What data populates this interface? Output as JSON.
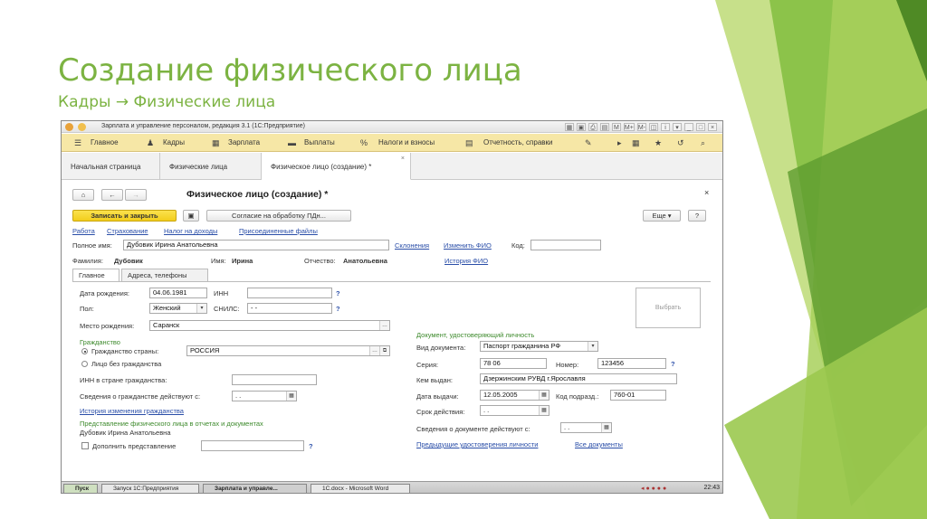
{
  "slide": {
    "title": "Создание физического лица",
    "subtitle": "Кадры → Физические лица"
  },
  "window": {
    "title": "Зарплата и управление персоналом, редакция 3.1 (1С:Предприятие)",
    "toolbar_icons": [
      "M",
      "M+",
      "M-"
    ]
  },
  "menu": {
    "items": [
      "Главное",
      "Кадры",
      "Зарплата",
      "Выплаты",
      "Налоги и взносы",
      "Отчетность, справки"
    ]
  },
  "page_tabs": [
    "Начальная страница",
    "Физические лица",
    "Физическое лицо (создание) *"
  ],
  "form": {
    "title": "Физическое лицо (создание) *",
    "save_close": "Записать и закрыть",
    "consent": "Согласие на обработку ПДн...",
    "more": "Еще",
    "help": "?",
    "links": [
      "Работа",
      "Страхование",
      "Налог на доходы",
      "Присоединенные файлы"
    ],
    "full_name_label": "Полное имя:",
    "full_name": "Дубовик Ирина Анатольевна",
    "declensions": "Склонения",
    "change_fio": "Изменить ФИО",
    "code_label": "Код:",
    "code": "",
    "surname_label": "Фамилия:",
    "surname": "Дубовик",
    "name_label": "Имя:",
    "name": "Ирина",
    "patronymic_label": "Отчество:",
    "patronymic": "Анатольевна",
    "fio_history": "История ФИО",
    "tabs": [
      "Главное",
      "Адреса, телефоны"
    ],
    "birth_date_label": "Дата рождения:",
    "birth_date": "04.06.1981",
    "inn_label": "ИНН",
    "inn": "",
    "sex_label": "Пол:",
    "sex": "Женский",
    "snils_label": "СНИЛС:",
    "snils": "-   -",
    "birthplace_label": "Место рождения:",
    "birthplace": "Саранск",
    "photo": "Выбрать",
    "citizenship_header": "Гражданство",
    "citizenship_country_label": "Гражданство страны:",
    "citizenship_country": "РОССИЯ",
    "stateless_label": "Лицо без гражданства",
    "foreign_inn_label": "ИНН в стране гражданства:",
    "citizenship_valid_label": "Сведения о гражданстве действуют с:",
    "citizenship_valid": ".   .",
    "citizenship_history": "История изменения гражданства",
    "representation_header": "Представление физического лица в отчетах и документах",
    "representation": "Дубовик Ирина Анатольевна",
    "supplement_label": "Дополнить представление",
    "doc_header": "Документ, удостоверяющий личность",
    "doc_type_label": "Вид документа:",
    "doc_type": "Паспорт гражданина РФ",
    "series_label": "Серия:",
    "series": "78 06",
    "number_label": "Номер:",
    "number": "123456",
    "issued_by_label": "Кем выдан:",
    "issued_by": "Дзержинским РУВД г.Ярославля",
    "issue_date_label": "Дата выдачи:",
    "issue_date": "12.05.2005",
    "division_code_label": "Код подразд.:",
    "division_code": "760-01",
    "valid_until_label": "Срок действия:",
    "valid_until": ".   .",
    "doc_valid_label": "Сведения о документе действуют с:",
    "doc_valid": ".   .",
    "previous_docs": "Предыдущие удостоверения личности",
    "all_docs": "Все документы"
  },
  "taskbar": {
    "start": "Пуск",
    "items": [
      "Запуск 1С:Предприятия",
      "Зарплата и управле...",
      "1C.docx - Microsoft Word"
    ],
    "clock": "22:43"
  },
  "colors": {
    "accent_green": "#7cb342",
    "menu_yellow": "#f6e7a6",
    "save_button": "#f2cd1c",
    "link_blue": "#2a4ea8",
    "header_green": "#3d8a2c"
  }
}
